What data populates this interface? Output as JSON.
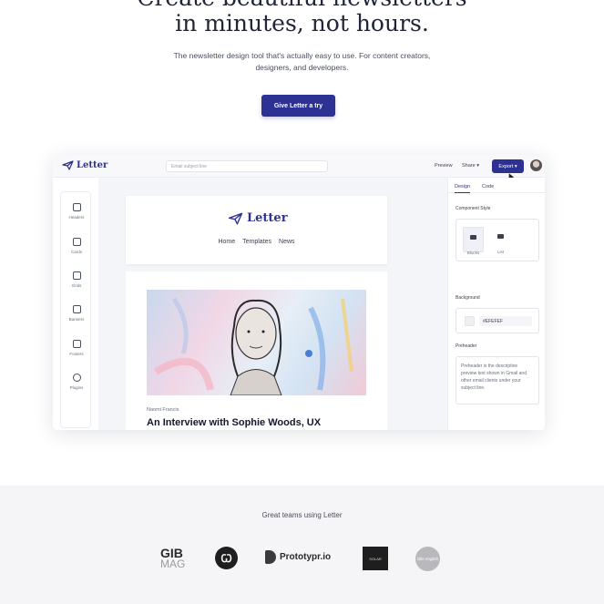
{
  "hero": {
    "title_line1": "Create beautiful newsletters",
    "title_line2": "in minutes, not hours.",
    "subtitle": "The newsletter design tool that's actually easy to use. For content creators, designers, and developers.",
    "cta_label": "Give Letter a try"
  },
  "app": {
    "brand": "Letter",
    "subject_placeholder": "Email subject line",
    "preview_label": "Preview",
    "share_label": "Share ▾",
    "export_label": "Export ▾",
    "sidebar": [
      {
        "label": "Headers",
        "icon": "headers-icon"
      },
      {
        "label": "Cards",
        "icon": "cards-icon"
      },
      {
        "label": "Grids",
        "icon": "grids-icon"
      },
      {
        "label": "Banners",
        "icon": "banners-icon"
      },
      {
        "label": "Footers",
        "icon": "footers-icon"
      },
      {
        "label": "Plugins",
        "icon": "plugins-icon"
      }
    ],
    "email": {
      "brand": "Letter",
      "nav": [
        "Home",
        "Templates",
        "News"
      ],
      "author": "Naomi Francis",
      "article_title": "An Interview with Sophie Woods, UX"
    },
    "panel": {
      "tabs": [
        "Design",
        "Code"
      ],
      "component_style_label": "Component Style",
      "style_options": [
        "Blocks",
        "List"
      ],
      "background_label": "Background",
      "background_value": "#EFEFEF",
      "preheader_label": "Preheader",
      "preheader_text": "Preheader is the descriptive preview text shown in Gmail and other email clients under your subject line."
    }
  },
  "logos": {
    "heading": "Great teams using Letter",
    "gib_top": "GIB",
    "gib_bottom": "MAG",
    "circle_mark": "Ꞷ",
    "prototypr": "Prototypr.io",
    "square_text": "SOLAR",
    "round_text": "little english"
  },
  "colors": {
    "brand": "#2d3194",
    "band": "#f5f5f7"
  }
}
